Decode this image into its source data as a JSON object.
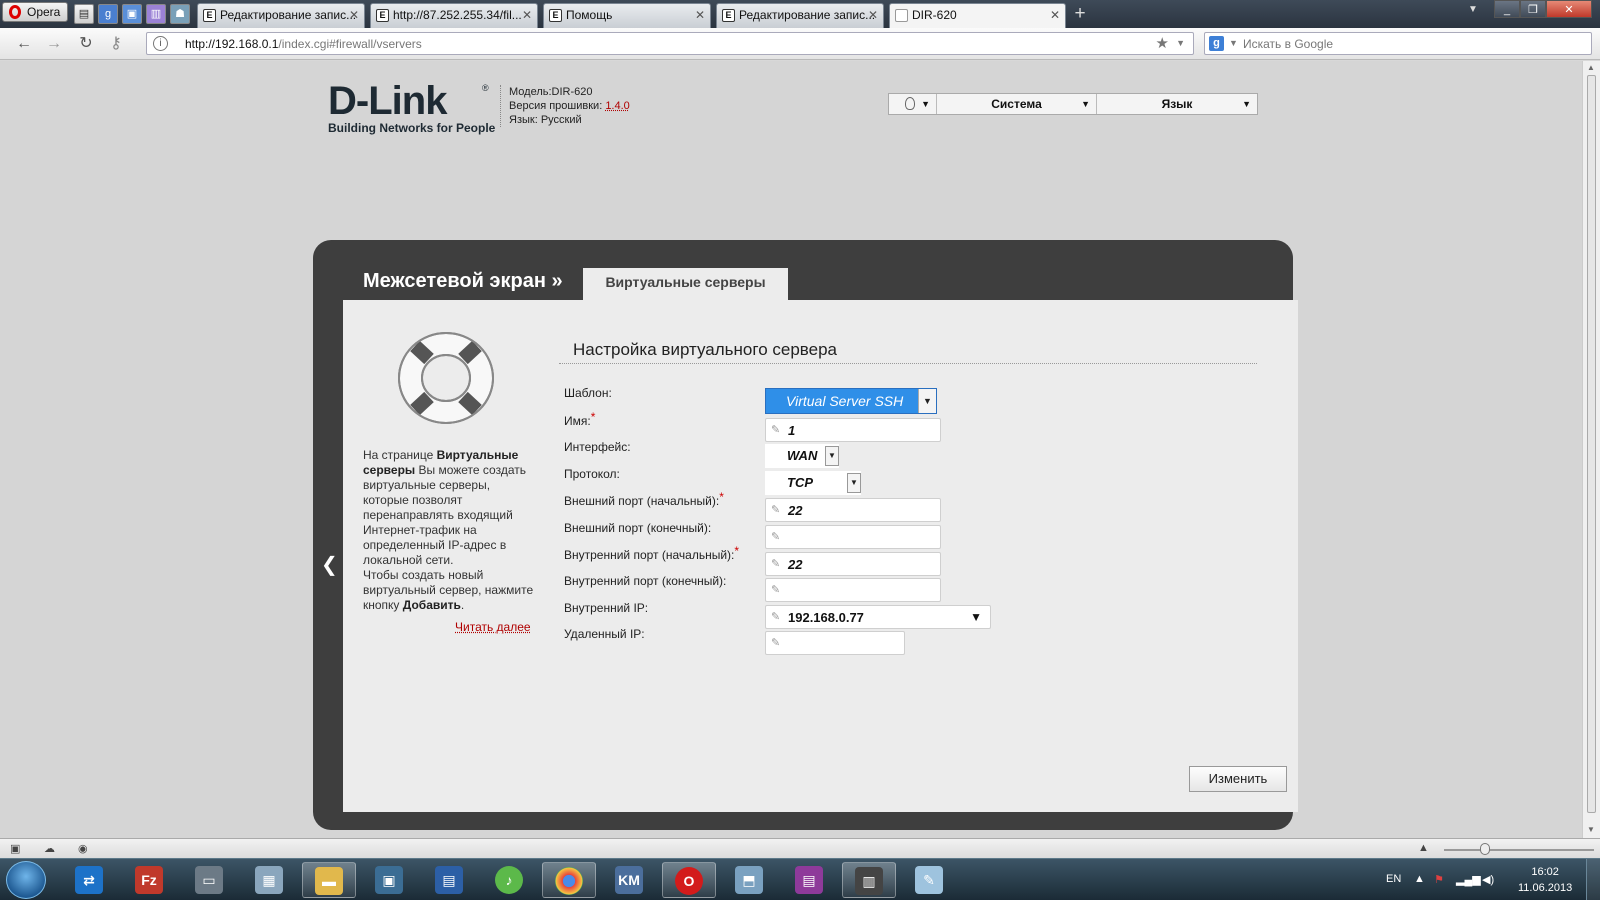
{
  "browser": {
    "menu_label": "Opera",
    "tabs": [
      {
        "title": "Редактирование запис...",
        "favicon": "page-icon"
      },
      {
        "title": "http://87.252.255.34/fil...",
        "favicon": "page-icon"
      },
      {
        "title": "Помощь",
        "favicon": "page-icon"
      },
      {
        "title": "Редактирование запис...",
        "favicon": "page-icon"
      },
      {
        "title": "DIR-620",
        "favicon": "blank-page-icon",
        "active": true
      }
    ],
    "url_host": "http://192.168.0.1",
    "url_rest": "/index.cgi#firewall/vservers",
    "search_placeholder": "Искать в Google",
    "search_engine_icon": "google-icon"
  },
  "router": {
    "brand": "D-Link",
    "tagline": "Building Networks for People",
    "model_line": "Модель:DIR-620",
    "firmware_label": "Версия прошивки:",
    "firmware_version": "1.4.0",
    "language_line": "Язык: Русский",
    "menu": {
      "system": "Система",
      "language": "Язык"
    }
  },
  "panel": {
    "section": "Межсетевой экран »",
    "tab": "Виртуальные серверы",
    "form_title": "Настройка виртуального сервера",
    "help": {
      "p1_pre": "На странице ",
      "p1_bold": "Виртуальные серверы",
      "p1_post": " Вы можете создать виртуальные серверы, которые позволят перенаправлять входящий Интернет-трафик на определенный IP-адрес в локальной сети.",
      "p2_pre": "Чтобы создать новый виртуальный сервер, нажмите кнопку ",
      "p2_bold": "Добавить",
      "p2_post": ".",
      "read_more": "Читать далее"
    },
    "fields": {
      "template": {
        "label": "Шаблон:",
        "value": "Virtual Server SSH"
      },
      "name": {
        "label": "Имя:",
        "value": "1",
        "required": true
      },
      "interface": {
        "label": "Интерфейс:",
        "value": "WAN"
      },
      "protocol": {
        "label": "Протокол:",
        "value": "TCP"
      },
      "ext_port_start": {
        "label": "Внешний порт (начальный):",
        "value": "22",
        "required": true
      },
      "ext_port_end": {
        "label": "Внешний порт (конечный):",
        "value": ""
      },
      "int_port_start": {
        "label": "Внутренний порт (начальный):",
        "value": "22",
        "required": true
      },
      "int_port_end": {
        "label": "Внутренний порт (конечный):",
        "value": ""
      },
      "internal_ip": {
        "label": "Внутренний IP:",
        "value": "192.168.0.77"
      },
      "remote_ip": {
        "label": "Удаленный IP:",
        "value": ""
      }
    },
    "required_mark": "*",
    "change_button": "Изменить"
  },
  "taskbar": {
    "language": "EN",
    "time": "16:02",
    "date": "11.06.2013",
    "apps": [
      "teamviewer-icon",
      "filezilla-icon",
      "computer-icon",
      "calculator-icon",
      "explorer-icon",
      "monitor-icon",
      "floppy-icon",
      "winamp-icon",
      "chrome-icon",
      "kmplayer-icon",
      "opera-icon",
      "network-icon",
      "winrar-icon",
      "movie-maker-icon",
      "paint-icon"
    ]
  }
}
